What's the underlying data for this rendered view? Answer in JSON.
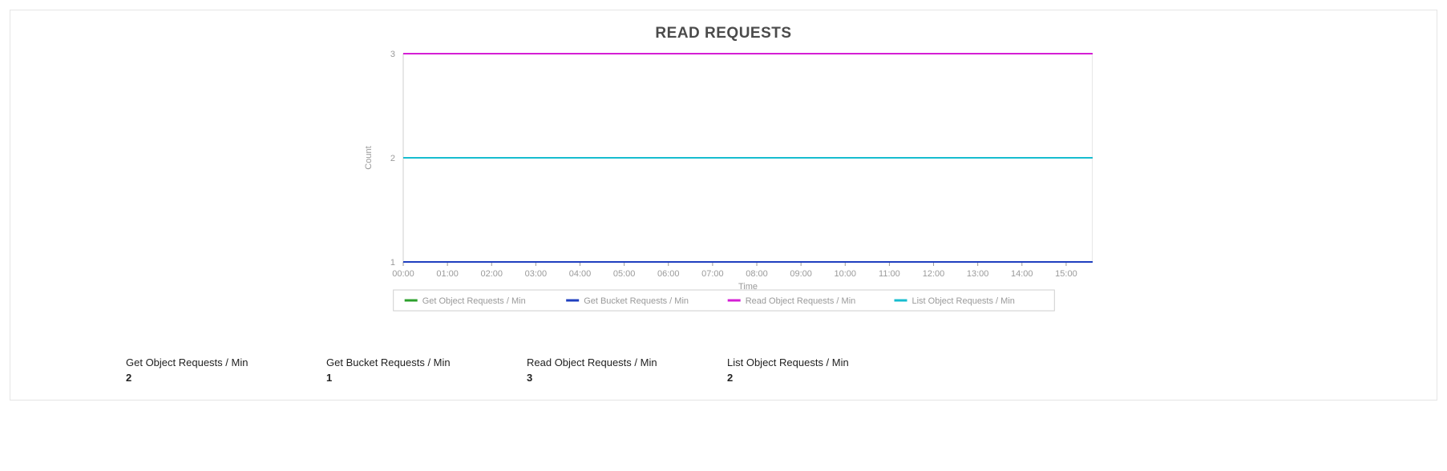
{
  "chart_data": {
    "type": "line",
    "title": "READ REQUESTS",
    "xlabel": "Time",
    "ylabel": "Count",
    "x_categories": [
      "00:00",
      "01:00",
      "02:00",
      "03:00",
      "04:00",
      "05:00",
      "06:00",
      "07:00",
      "08:00",
      "09:00",
      "10:00",
      "11:00",
      "12:00",
      "13:00",
      "14:00",
      "15:00"
    ],
    "ylim": [
      1,
      3
    ],
    "yticks": [
      1,
      2,
      3
    ],
    "series": [
      {
        "name": "Get Object Requests / Min",
        "color": "#2ca02c",
        "values": [
          2,
          2,
          2,
          2,
          2,
          2,
          2,
          2,
          2,
          2,
          2,
          2,
          2,
          2,
          2,
          2
        ]
      },
      {
        "name": "Get Bucket Requests / Min",
        "color": "#1f3fbf",
        "values": [
          1,
          1,
          1,
          1,
          1,
          1,
          1,
          1,
          1,
          1,
          1,
          1,
          1,
          1,
          1,
          1
        ]
      },
      {
        "name": "Read Object Requests / Min",
        "color": "#d41fd4",
        "values": [
          3,
          3,
          3,
          3,
          3,
          3,
          3,
          3,
          3,
          3,
          3,
          3,
          3,
          3,
          3,
          3
        ]
      },
      {
        "name": "List Object Requests / Min",
        "color": "#17bccf",
        "values": [
          2,
          2,
          2,
          2,
          2,
          2,
          2,
          2,
          2,
          2,
          2,
          2,
          2,
          2,
          2,
          2
        ]
      }
    ]
  },
  "legend": [
    {
      "label": "Get Object Requests / Min",
      "swatch_color": "#2ca02c"
    },
    {
      "label": "Get Bucket Requests / Min",
      "swatch_color": "#1f3fbf"
    },
    {
      "label": "Read Object Requests / Min",
      "swatch_color": "#d41fd4"
    },
    {
      "label": "List Object Requests / Min",
      "swatch_color": "#17bccf"
    }
  ],
  "summary_stats": [
    {
      "label": "Get Object Requests / Min",
      "value": "2"
    },
    {
      "label": "Get Bucket Requests / Min",
      "value": "1"
    },
    {
      "label": "Read Object Requests / Min",
      "value": "3"
    },
    {
      "label": "List Object Requests / Min",
      "value": "2"
    }
  ]
}
